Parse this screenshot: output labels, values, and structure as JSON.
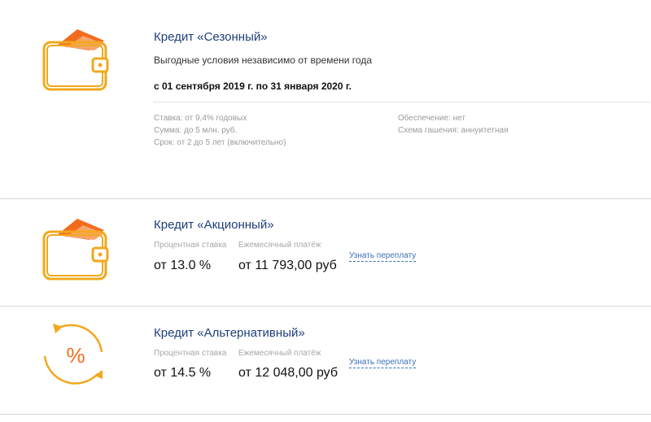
{
  "offers": [
    {
      "title": "Кредит «Сезонный»",
      "subtitle": "Выгодные условия независимо от времени года",
      "period": "с 01 сентября 2019 г. по 31 января 2020 г.",
      "details_left": [
        "Ставка: от 9,4% годовых",
        "Сумма: до 5 млн. руб.",
        "Срок: от 2 до 5 лет (включительно)"
      ],
      "details_right": [
        "Обеспечение: нет",
        "Схема гашения: аннуитетная"
      ],
      "icon": "wallet-icon"
    },
    {
      "title": "Кредит «Акционный»",
      "rate_label": "Процентная ставка",
      "rate_value": "от 13.0 %",
      "payment_label": "Ежемесячный платёж",
      "payment_value": "от 11 793,00 руб",
      "link": "Узнать переплату",
      "icon": "wallet-icon"
    },
    {
      "title": "Кредит «Альтернативный»",
      "rate_label": "Процентная ставка",
      "rate_value": "от 14.5 %",
      "payment_label": "Ежемесячный платёж",
      "payment_value": "от 12 048,00 руб",
      "link": "Узнать переплату",
      "icon": "percent-cycle-icon"
    }
  ],
  "colors": {
    "accent": "#f2a81d",
    "icon_orange": "#f26b1d",
    "title": "#1f3e7a",
    "link": "#3a6fb8"
  }
}
